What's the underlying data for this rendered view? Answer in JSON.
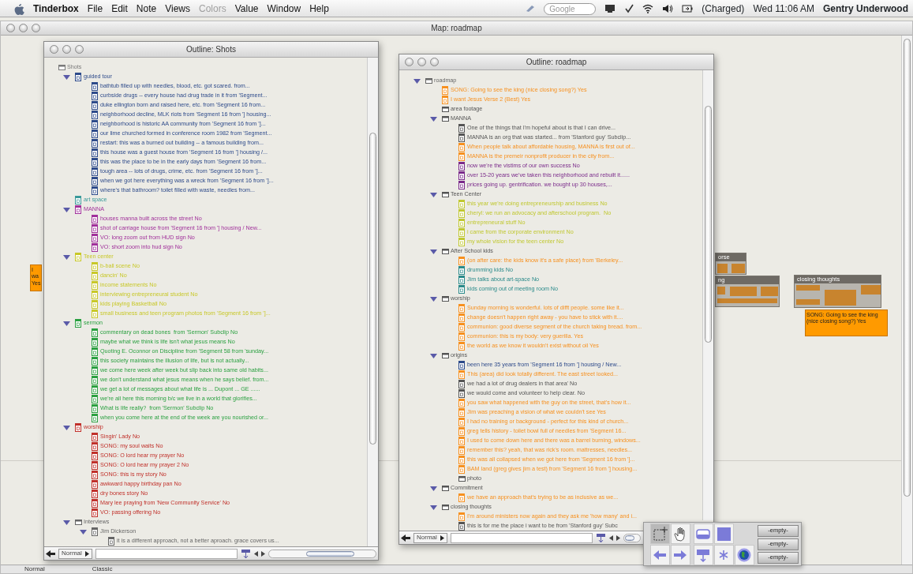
{
  "menubar": {
    "menus": [
      {
        "label": "Tinderbox",
        "kind": "app",
        "disabled": false
      },
      {
        "label": "File",
        "kind": "menu",
        "disabled": false
      },
      {
        "label": "Edit",
        "kind": "menu",
        "disabled": false
      },
      {
        "label": "Note",
        "kind": "menu",
        "disabled": false
      },
      {
        "label": "Views",
        "kind": "menu",
        "disabled": false
      },
      {
        "label": "Colors",
        "kind": "menu",
        "disabled": true
      },
      {
        "label": "Value",
        "kind": "menu",
        "disabled": false
      },
      {
        "label": "Window",
        "kind": "menu",
        "disabled": false
      },
      {
        "label": "Help",
        "kind": "menu",
        "disabled": false
      }
    ],
    "search_placeholder": "Google",
    "battery": "(Charged)",
    "clock": "Wed 11:06 AM",
    "user": "Gentry Underwood"
  },
  "map_window": {
    "title": "Map: roadmap",
    "notes": [
      {
        "text": "I wa\nYes"
      },
      {
        "text": "SONG: Going to see the king (nice closing song?) Yes"
      }
    ],
    "containers": [
      {
        "title": "orse"
      },
      {
        "title": "ng"
      },
      {
        "title": "closing thoughts"
      }
    ],
    "status_bar": [
      "Normal",
      "Classic"
    ]
  },
  "outlines": [
    {
      "title": "Outline: Shots",
      "view_mode": "Normal",
      "items": [
        {
          "text": "Shots",
          "kind": "group",
          "color": "#7a7a7a",
          "children": [
            {
              "text": "guided tour",
              "kind": "note",
              "color": "#2d4a8a",
              "expanded": true,
              "children": [
                {
                  "text": "bathtub filled up with needles, blood, etc. got scared. from...",
                  "kind": "note",
                  "color": "#2d4a8a"
                },
                {
                  "text": "curbside drugs -- every house had drug trade in it from 'Segment...",
                  "kind": "note",
                  "color": "#2d4a8a"
                },
                {
                  "text": "duke ellington born and raised here, etc. from 'Segment 16 from...",
                  "kind": "note",
                  "color": "#2d4a8a"
                },
                {
                  "text": "neighborhood decline, MLK riots from 'Segment 16 from '] housing...",
                  "kind": "note",
                  "color": "#2d4a8a"
                },
                {
                  "text": "neighborhood is historic AA community from 'Segment 16 from ']...",
                  "kind": "note",
                  "color": "#2d4a8a"
                },
                {
                  "text": "our lime churched formed in conference room 1982 from 'Segment...",
                  "kind": "note",
                  "color": "#2d4a8a"
                },
                {
                  "text": "restart: this was a burned out building -- a famous building from...",
                  "kind": "note",
                  "color": "#2d4a8a"
                },
                {
                  "text": "this house was a guest house from 'Segment 16 from '] housing /...",
                  "kind": "note",
                  "color": "#2d4a8a"
                },
                {
                  "text": "this was the place to be in the early days from 'Segment 16 from...",
                  "kind": "note",
                  "color": "#2d4a8a"
                },
                {
                  "text": "tough area -- lots of drugs, crime, etc. from 'Segment 16 from ']...",
                  "kind": "note",
                  "color": "#2d4a8a"
                },
                {
                  "text": "when we got here everything was a wreck from 'Segment 16 from ']...",
                  "kind": "note",
                  "color": "#2d4a8a"
                },
                {
                  "text": "where's that bathroom? toilet filled with waste, needles from...",
                  "kind": "note",
                  "color": "#2d4a8a"
                }
              ]
            },
            {
              "text": "art space",
              "kind": "note",
              "color": "#3a9a9a"
            },
            {
              "text": "MANNA",
              "kind": "note",
              "color": "#a0309a",
              "expanded": true,
              "children": [
                {
                  "text": "houses manna built across the street No",
                  "kind": "note",
                  "color": "#a0309a"
                },
                {
                  "text": "shot of carriage house from 'Segment 16 from '] housing / New...",
                  "kind": "note",
                  "color": "#a0309a"
                },
                {
                  "text": "VO: long zoom out from HUD sign No",
                  "kind": "note",
                  "color": "#a0309a"
                },
                {
                  "text": "VO: short zoom into hud sign No",
                  "kind": "note",
                  "color": "#a0309a"
                }
              ]
            },
            {
              "text": "Teen center",
              "kind": "note",
              "color": "#c8c828",
              "expanded": true,
              "children": [
                {
                  "text": "b-ball scene No",
                  "kind": "note",
                  "color": "#c8c828"
                },
                {
                  "text": "dancin' No",
                  "kind": "note",
                  "color": "#c8c828"
                },
                {
                  "text": "income statements No",
                  "kind": "note",
                  "color": "#c8c828"
                },
                {
                  "text": "interviewing entrepreneural student No",
                  "kind": "note",
                  "color": "#c8c828"
                },
                {
                  "text": "kids playing Basketball No",
                  "kind": "note",
                  "color": "#c8c828"
                },
                {
                  "text": "small business and teen program photos from 'Segment 16 from ']...",
                  "kind": "note",
                  "color": "#c8c828"
                }
              ]
            },
            {
              "text": "sermon",
              "kind": "note",
              "color": "#2aa040",
              "expanded": true,
              "children": [
                {
                  "text": "commentary on dead bones  from 'Sermon' Subclip No",
                  "kind": "note",
                  "color": "#2aa040"
                },
                {
                  "text": "maybe what we think is life isn't what jesus means No",
                  "kind": "note",
                  "color": "#2aa040"
                },
                {
                  "text": "Quoting E. Oconnor on Discipline from 'Segment 58 from 'sunday...",
                  "kind": "note",
                  "color": "#2aa040"
                },
                {
                  "text": "this society maintains the illusion of life, but is not actually...",
                  "kind": "note",
                  "color": "#2aa040"
                },
                {
                  "text": "we come here week after week but slip back into same old habits...",
                  "kind": "note",
                  "color": "#2aa040"
                },
                {
                  "text": "we don't understand what jesus means when he says belief. from...",
                  "kind": "note",
                  "color": "#2aa040"
                },
                {
                  "text": "we get a lot of messages about what life is ... Dupont ... GE ......",
                  "kind": "note",
                  "color": "#2aa040"
                },
                {
                  "text": "we're all here this morning b/c we live in a world that glorifies...",
                  "kind": "note",
                  "color": "#2aa040"
                },
                {
                  "text": "What is life really?  from 'Sermon' Subclip No",
                  "kind": "note",
                  "color": "#2aa040"
                },
                {
                  "text": "when you come here at the end of the week are you nourished or...",
                  "kind": "note",
                  "color": "#2aa040"
                }
              ]
            },
            {
              "text": "worship",
              "kind": "note",
              "color": "#c0302a",
              "expanded": true,
              "children": [
                {
                  "text": "Singin' Lady No",
                  "kind": "note",
                  "color": "#c0302a"
                },
                {
                  "text": "SONG: my soul waits No",
                  "kind": "note",
                  "color": "#c0302a"
                },
                {
                  "text": "SONG: O lord hear my prayer No",
                  "kind": "note",
                  "color": "#c0302a"
                },
                {
                  "text": "SONG: O lord hear my prayer 2 No",
                  "kind": "note",
                  "color": "#c0302a"
                },
                {
                  "text": "SONG: this is my story No",
                  "kind": "note",
                  "color": "#c0302a"
                },
                {
                  "text": "awkward happy birthday pan No",
                  "kind": "note",
                  "color": "#c0302a"
                },
                {
                  "text": "dry bones story No",
                  "kind": "note",
                  "color": "#c0302a"
                },
                {
                  "text": "Mary lee praying from 'New Community Service' No",
                  "kind": "note",
                  "color": "#c0302a"
                },
                {
                  "text": "VO: passing offering No",
                  "kind": "note",
                  "color": "#c0302a"
                }
              ]
            },
            {
              "text": "Interviews",
              "kind": "group",
              "color": "#666666",
              "expanded": true,
              "children": [
                {
                  "text": "Jim Dickerson",
                  "kind": "note",
                  "color": "#666666",
                  "expanded": true,
                  "children": [
                    {
                      "text": "it is a different approach, not a better aproach. grace covers us...",
                      "kind": "note",
                      "color": "#666666"
                    }
                  ]
                }
              ]
            }
          ]
        }
      ]
    },
    {
      "title": "Outline: roadmap",
      "view_mode": "Normal",
      "items": [
        {
          "text": "roadmap",
          "kind": "group",
          "color": "#666666",
          "expanded": true,
          "children": [
            {
              "text": "SONG: Going to see the king (nice closing song?) Yes",
              "kind": "note",
              "color": "#f7901e"
            },
            {
              "text": "I want Jesus Verse 2 (Best) Yes",
              "kind": "note",
              "color": "#f7901e"
            },
            {
              "text": "area footage",
              "kind": "group",
              "color": "#555555"
            },
            {
              "text": "MANNA",
              "kind": "group",
              "color": "#555555",
              "expanded": true,
              "children": [
                {
                  "text": "One of the things that I'm hopeful about is that I can drive...",
                  "kind": "note",
                  "color": "#555555"
                },
                {
                  "text": "MANNA is an org that was started... from 'Stanford guy' Subclip...",
                  "kind": "note",
                  "color": "#555555"
                },
                {
                  "text": "When people talk about affordable housing, MANNA is first out of...",
                  "kind": "note",
                  "color": "#f7901e"
                },
                {
                  "text": "MANNA is the premeir nonprofit producer in the city from...",
                  "kind": "note",
                  "color": "#f7901e"
                },
                {
                  "text": "now we're the vistims of our own success No",
                  "kind": "note",
                  "color": "#7a2a8a"
                },
                {
                  "text": "over 15-20 years we've taken this neighborhood and rebuilt it......",
                  "kind": "note",
                  "color": "#7a2a8a"
                },
                {
                  "text": "prices going up. gentrification. we bought up 30 houses,...",
                  "kind": "note",
                  "color": "#7a2a8a"
                }
              ]
            },
            {
              "text": "Teen Center",
              "kind": "group",
              "color": "#555555",
              "expanded": true,
              "children": [
                {
                  "text": "this year we're doing entrepreneurship and business No",
                  "kind": "note",
                  "color": "#c0c830"
                },
                {
                  "text": "cheryl: we run an advocacy and afterschool program.  No",
                  "kind": "note",
                  "color": "#c0c830"
                },
                {
                  "text": "entrepreneural stuff No",
                  "kind": "note",
                  "color": "#c0c830"
                },
                {
                  "text": "i came from the corporate environment No",
                  "kind": "note",
                  "color": "#c0c830"
                },
                {
                  "text": "my whole vision for the teen center No",
                  "kind": "note",
                  "color": "#c0c830"
                }
              ]
            },
            {
              "text": "After School kids",
              "kind": "group",
              "color": "#555555",
              "expanded": true,
              "children": [
                {
                  "text": "(on after care: the kids know it's a safe place) from 'Berkeley...",
                  "kind": "note",
                  "color": "#f7901e"
                },
                {
                  "text": "drumming kids No",
                  "kind": "note",
                  "color": "#2a8a8a"
                },
                {
                  "text": "Jim talks about art-space No",
                  "kind": "note",
                  "color": "#2a8a8a"
                },
                {
                  "text": "kids coming out of meeting room No",
                  "kind": "note",
                  "color": "#2a8a8a"
                }
              ]
            },
            {
              "text": "worship",
              "kind": "group",
              "color": "#555555",
              "expanded": true,
              "children": [
                {
                  "text": "Sunday morning is wonderful. lots of difft people. some like it...",
                  "kind": "note",
                  "color": "#f7901e"
                },
                {
                  "text": "change doesn't happen right away - you have to stick with it....",
                  "kind": "note",
                  "color": "#f7901e"
                },
                {
                  "text": "communion: good diverse segment of the church taking bread. from...",
                  "kind": "note",
                  "color": "#f7901e"
                },
                {
                  "text": "communion: this is my body: very guerilla. Yes",
                  "kind": "note",
                  "color": "#f7901e"
                },
                {
                  "text": "the world as we know it wouldn't exist without oil Yes",
                  "kind": "note",
                  "color": "#f7901e"
                }
              ]
            },
            {
              "text": "origins",
              "kind": "group",
              "color": "#555555",
              "expanded": true,
              "children": [
                {
                  "text": "been here 35 years from 'Segment 16 from '] housing / New...",
                  "kind": "note",
                  "color": "#2d4a8a"
                },
                {
                  "text": "This (area) did look totally different. The east street looked...",
                  "kind": "note",
                  "color": "#f7901e"
                },
                {
                  "text": "we had a lot of drug dealers in that area' No",
                  "kind": "note",
                  "color": "#555555"
                },
                {
                  "text": "we would come and volunteer to help clear. No",
                  "kind": "note",
                  "color": "#555555"
                },
                {
                  "text": "you saw what happened with the guy on the street, that's how it...",
                  "kind": "note",
                  "color": "#f7901e"
                },
                {
                  "text": "Jim was preaching a vision of what we couldn't see Yes",
                  "kind": "note",
                  "color": "#f7901e"
                },
                {
                  "text": "I had no training or background - perfect for this kind of church...",
                  "kind": "note",
                  "color": "#f7901e"
                },
                {
                  "text": "greg tells history - toilet bowl full of needles from 'Segment 16...",
                  "kind": "note",
                  "color": "#f7901e"
                },
                {
                  "text": "I used to come down here and there was a barrel burning, windows...",
                  "kind": "note",
                  "color": "#f7901e"
                },
                {
                  "text": "remember this? yeah, that was rick's room. mattresses, needles...",
                  "kind": "note",
                  "color": "#f7901e"
                },
                {
                  "text": "this was all collapsed when we got here from 'Segment 16 from ']...",
                  "kind": "note",
                  "color": "#f7901e"
                },
                {
                  "text": "BAM land (greg gives jim a test) from 'Segment 16 from '] housing...",
                  "kind": "note",
                  "color": "#f7901e"
                },
                {
                  "text": "photo",
                  "kind": "group",
                  "color": "#555555"
                }
              ]
            },
            {
              "text": "Commitment",
              "kind": "group",
              "color": "#555555",
              "expanded": true,
              "children": [
                {
                  "text": "we have an approach that's trying to be as inclusive as we...",
                  "kind": "note",
                  "color": "#f7901e"
                }
              ]
            },
            {
              "text": "closing thoughts",
              "kind": "group",
              "color": "#555555",
              "expanded": true,
              "children": [
                {
                  "text": "I'm around ministers now again and they ask me 'how many' and i...",
                  "kind": "note",
                  "color": "#f7901e"
                },
                {
                  "text": "this is for me the place i want to be from 'Stanford guy' Subc",
                  "kind": "note",
                  "color": "#555555"
                }
              ]
            }
          ]
        }
      ]
    }
  ],
  "palette": {
    "slots": [
      "-empty-",
      "-empty-",
      "-empty-"
    ]
  }
}
